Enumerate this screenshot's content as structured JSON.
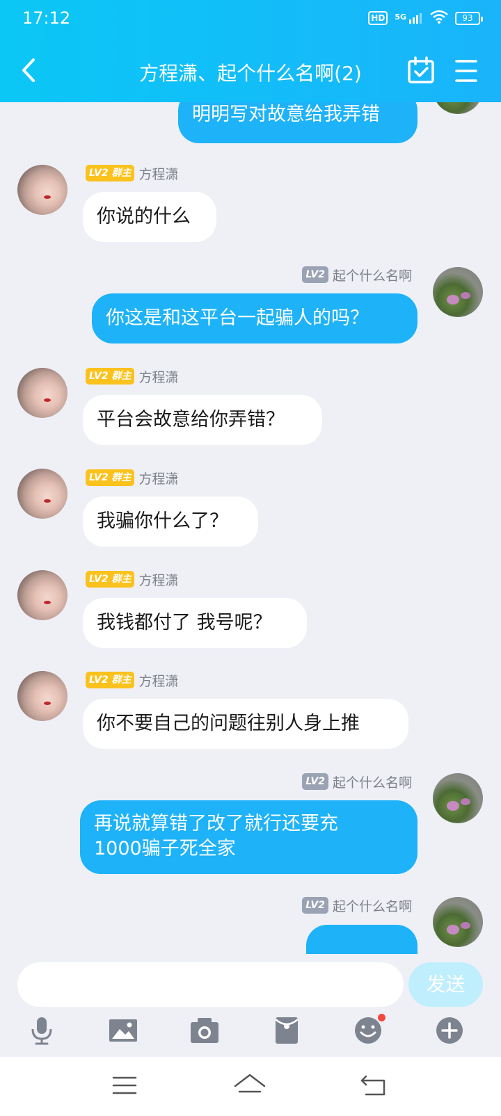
{
  "status": {
    "time": "17:12",
    "hd": "HD",
    "network": "5G",
    "battery": "93"
  },
  "header": {
    "title": "方程潇、起个什么名啊(2)"
  },
  "input": {
    "placeholder": "",
    "send_label": "发送"
  },
  "colors": {
    "header_start": "#0bc7f6",
    "header_end": "#19b4fa",
    "bubble_self": "#1eb2f8",
    "owner_badge": "#fbc21d",
    "level_badge": "#9aa2b3",
    "notification_dot": "#f3473b"
  },
  "messages": [
    {
      "side": "right",
      "text": "明明写对故意给我弄错"
    },
    {
      "side": "left",
      "level": "LV2",
      "role": "群主",
      "name": "方程潇",
      "text": "你说的什么"
    },
    {
      "side": "right",
      "level": "LV2",
      "name": "起个什么名啊",
      "text": "你这是和这平台一起骗人的吗？"
    },
    {
      "side": "left",
      "level": "LV2",
      "role": "群主",
      "name": "方程潇",
      "text": "平台会故意给你弄错？"
    },
    {
      "side": "left",
      "level": "LV2",
      "role": "群主",
      "name": "方程潇",
      "text": "我骗你什么了？"
    },
    {
      "side": "left",
      "level": "LV2",
      "role": "群主",
      "name": "方程潇",
      "text": "我钱都付了 我号呢？"
    },
    {
      "side": "left",
      "level": "LV2",
      "role": "群主",
      "name": "方程潇",
      "text": "你不要自己的问题往别人身上推"
    },
    {
      "side": "right",
      "level": "LV2",
      "name": "起个什么名啊",
      "text_line1": "再说就算错了改了就行还要充",
      "text_line2": "1000骗子死全家"
    },
    {
      "side": "right",
      "level": "LV2",
      "name": "起个什么名啊",
      "text": ""
    }
  ],
  "toolbar": {
    "icons": [
      "microphone-icon",
      "image-icon",
      "camera-icon",
      "red-packet-icon",
      "emoji-icon",
      "plus-icon"
    ]
  },
  "navigation": {
    "icons": [
      "menu-icon",
      "home-icon",
      "back-icon"
    ]
  }
}
